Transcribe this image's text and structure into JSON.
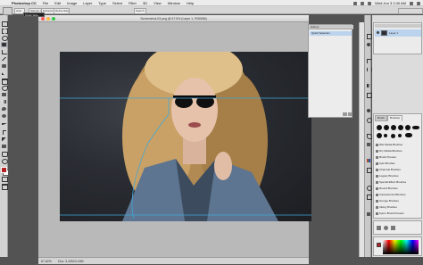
{
  "menubar": {
    "apple": "",
    "items": [
      "Photoshop CC",
      "File",
      "Edit",
      "Image",
      "Layer",
      "Type",
      "Select",
      "Filter",
      "3D",
      "View",
      "Window",
      "Help"
    ],
    "clock": "Wed Jun 3  2:40 AM"
  },
  "optbar": {
    "fields": [
      "Auto",
      "Sample All",
      "Enhance",
      "Refine Edge..."
    ],
    "search": "Search"
  },
  "tooltip": {
    "text": "Quick Sele..."
  },
  "document": {
    "title": "Screenshot-03.png @ 67.6% (Layer 1, RGB/8#)",
    "zoom": "67.62%",
    "doc_info": "Doc: 3.43M/3.43M"
  },
  "history": {
    "tab": "History",
    "item": "Quick Selection"
  },
  "layers": {
    "layer_name": "Layer 1",
    "thumb_icon": "eye-icon"
  },
  "brushes": {
    "tabs": [
      "Brush",
      "Brushes"
    ],
    "sets": [
      "Wet Media Brushes",
      "Dry Media Brushes",
      "Brush Presets",
      "Kyle Brushes",
      "Charcoal Brushes",
      "Legacy Brushes",
      "Special Effect Brushes",
      "Round Brushes",
      "Impressionist Brushes",
      "Grunge Brushes",
      "Inking Brushes",
      "Kyle's Brush Presets"
    ]
  },
  "color": {
    "fg": "#b22222",
    "bg": "#ffffff"
  }
}
